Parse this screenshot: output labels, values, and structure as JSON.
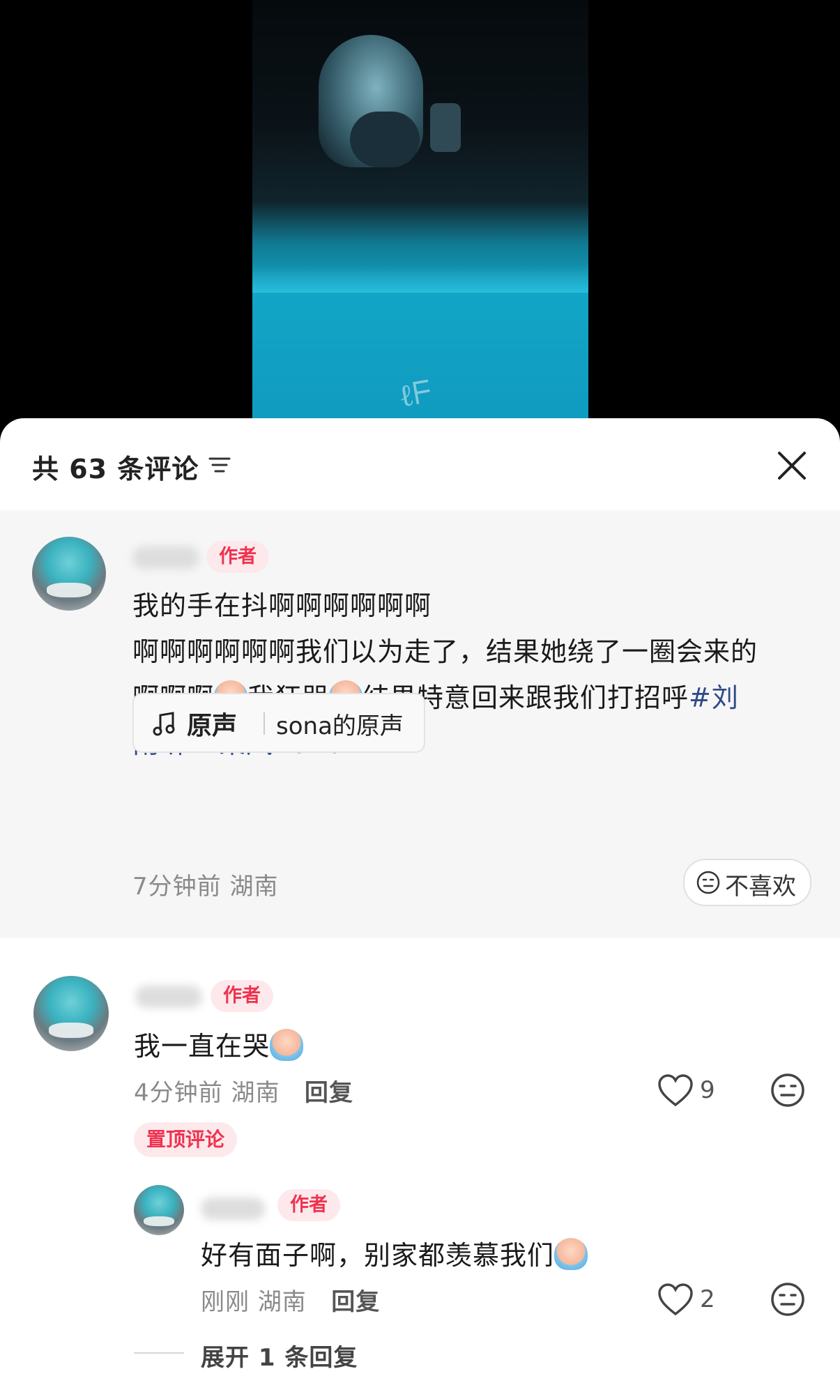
{
  "header": {
    "comment_count": "共 63 条评论"
  },
  "pinned_comment": {
    "author_tag": "作者",
    "lines": [
      "我的手在抖啊啊啊啊啊啊",
      "啊啊啊啊啊啊我们以为走了，结果她绕了一圈会来的",
      {
        "a": "啊啊啊",
        "b": "我狂哭",
        "c": "结果特意回来跟我们打招呼",
        "tag1": "#刘"
      },
      {
        "tag1_cont": "雨昕",
        "tag2": "#乘风2026"
      }
    ],
    "music_label": "原声",
    "music_name": "sona的原声",
    "time": "7分钟前",
    "location": "湖南",
    "dislike_label": "不喜欢"
  },
  "comment": {
    "author_tag": "作者",
    "text": "我一直在哭",
    "time": "4分钟前",
    "location": "湖南",
    "reply_label": "回复",
    "likes": "9",
    "pin_tag": "置顶评论"
  },
  "reply": {
    "author_tag": "作者",
    "text": "好有面子啊，别家都羡慕我们",
    "time": "刚刚",
    "location": "湖南",
    "reply_label": "回复",
    "likes": "2"
  },
  "expand_replies": "展开 1 条回复"
}
